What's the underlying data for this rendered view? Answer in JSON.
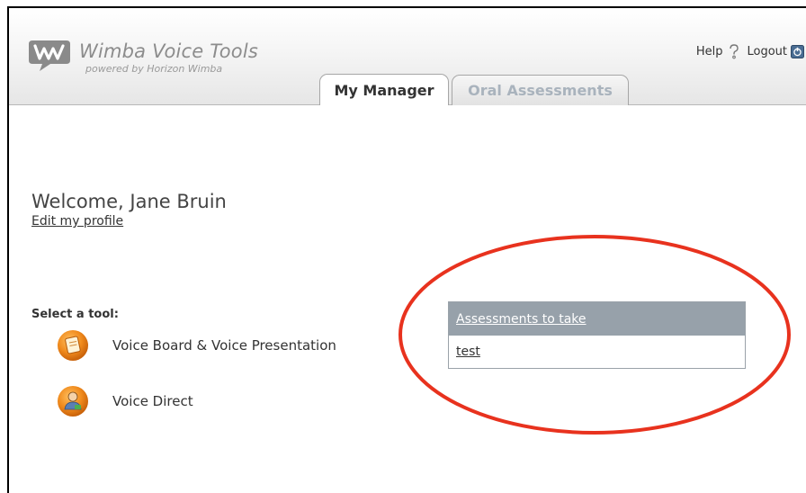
{
  "header": {
    "brand_title": "Wimba Voice Tools",
    "brand_subtitle": "powered by Horizon Wimba",
    "help_label": "Help",
    "logout_label": "Logout"
  },
  "tabs": [
    {
      "label": "My Manager",
      "active": true
    },
    {
      "label": "Oral Assessments",
      "active": false
    }
  ],
  "main": {
    "welcome": "Welcome, Jane Bruin",
    "edit_profile": "Edit my profile",
    "select_tool": "Select a tool:",
    "tools": [
      {
        "label": "Voice Board & Voice Presentation",
        "icon": "voice-board-icon"
      },
      {
        "label": "Voice Direct",
        "icon": "voice-direct-icon"
      }
    ]
  },
  "assessments": {
    "header": "Assessments to take",
    "items": [
      "test"
    ]
  },
  "colors": {
    "tool_icon_orange": "#f08a1c",
    "assessments_header": "#97a1aa",
    "annotation_circle": "#e8321e"
  }
}
